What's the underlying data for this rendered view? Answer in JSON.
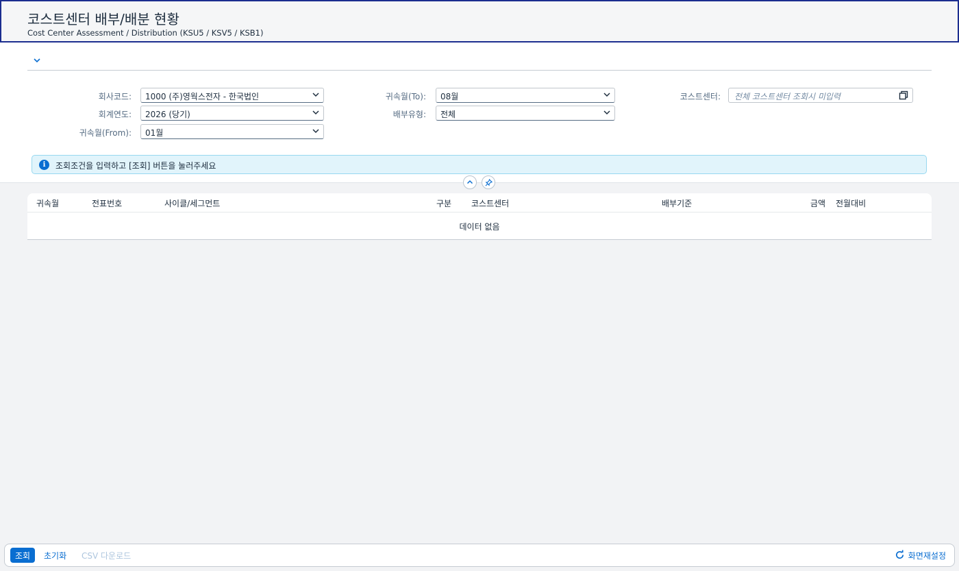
{
  "header": {
    "title": "코스트센터 배부/배분 현황",
    "subtitle": "Cost Center Assessment / Distribution (KSU5 / KSV5 / KSB1)"
  },
  "filters": {
    "company_code": {
      "label": "회사코드:",
      "value": "1000 (주)영웍스전자 - 한국법인"
    },
    "fiscal_year": {
      "label": "회계연도:",
      "value": "2026 (당기)"
    },
    "period_from": {
      "label": "귀속월(From):",
      "value": "01월"
    },
    "period_to": {
      "label": "귀속월(To):",
      "value": "08월"
    },
    "alloc_type": {
      "label": "배부유형:",
      "value": "전체"
    },
    "cost_center": {
      "label": "코스트센터:",
      "placeholder": "전체 코스트센터 조회시 미입력"
    }
  },
  "message": "조회조건을 입력하고 [조회] 버튼을 눌러주세요",
  "table": {
    "columns": [
      "귀속월",
      "전표번호",
      "사이클/세그먼트",
      "구분",
      "코스트센터",
      "배부기준",
      "금액",
      "전월대비"
    ],
    "no_data": "데이터 없음"
  },
  "footer": {
    "search": "조회",
    "reset": "초기화",
    "csv": "CSV 다운로드",
    "refresh": "화면재설정"
  },
  "colors": {
    "accent": "#0a6ed1",
    "header_border": "#1b2d8f",
    "info_bg": "#e1f4fb"
  }
}
